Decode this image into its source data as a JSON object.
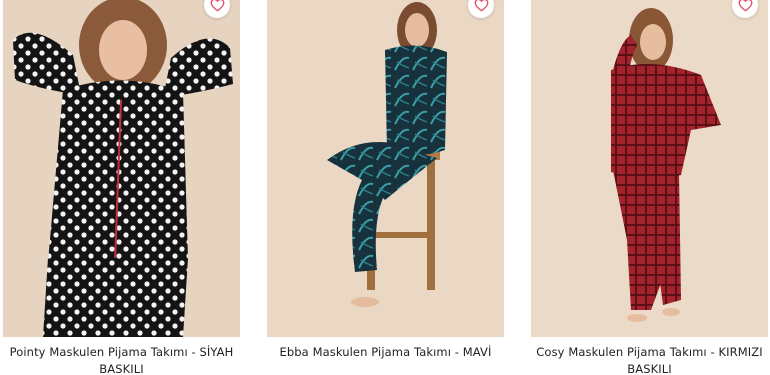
{
  "theme": {
    "background": "#ffffff",
    "photo_background": "#e9d7c3",
    "favorite_heart_color": "#e0566f",
    "title_color": "#222222"
  },
  "products": [
    {
      "title": "Pointy Maskulen Pijama Takımı - SİYAH BASKILI",
      "garment_color": "#161616",
      "icon": "heart-icon"
    },
    {
      "title": "Ebba Maskulen Pijama Takımı - MAVİ",
      "garment_color": "#1e4a57",
      "icon": "heart-icon"
    },
    {
      "title": "Cosy Maskulen Pijama Takımı - KIRMIZI BASKILI",
      "garment_color": "#a5262e",
      "icon": "heart-icon"
    }
  ]
}
